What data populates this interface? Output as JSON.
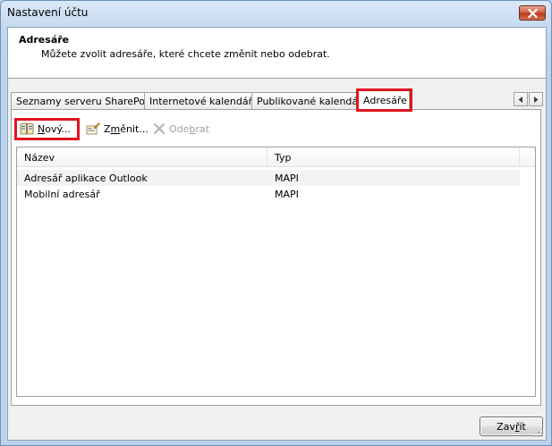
{
  "window": {
    "title": "Nastavení účtu"
  },
  "header": {
    "title": "Adresáře",
    "description": "Můžete zvolit adresáře, které chcete změnit nebo odebrat."
  },
  "tabs": [
    {
      "label": "Seznamy serveru SharePoint",
      "active": false
    },
    {
      "label": "Internetové kalendáře",
      "active": false
    },
    {
      "label": "Publikované kalendáře",
      "active": false
    },
    {
      "label": "Adresáře",
      "active": true
    }
  ],
  "toolbar": {
    "new_label_mnemonic": "N",
    "new_label_rest": "ový...",
    "edit_label_pre": "Z",
    "edit_label_mnemonic": "m",
    "edit_label_rest": "ěnit...",
    "remove_label_pre": "Ode",
    "remove_label_mnemonic": "b",
    "remove_label_rest": "rat"
  },
  "list": {
    "columns": [
      "Název",
      "Typ"
    ],
    "rows": [
      {
        "name": "Adresář aplikace Outlook",
        "type": "MAPI"
      },
      {
        "name": "Mobilní adresář",
        "type": "MAPI"
      }
    ]
  },
  "footer": {
    "close_label_pre": "Zav",
    "close_label_mnemonic": "ř",
    "close_label_rest": "ít"
  },
  "colors": {
    "highlight": "#e0141e",
    "close_button_red": "#cf5a3f"
  },
  "icons": {
    "close": "close-x-icon",
    "new": "address-book-icon",
    "edit": "edit-properties-icon",
    "remove": "delete-x-icon",
    "scroll_left": "arrow-left-icon",
    "scroll_right": "arrow-right-icon"
  }
}
